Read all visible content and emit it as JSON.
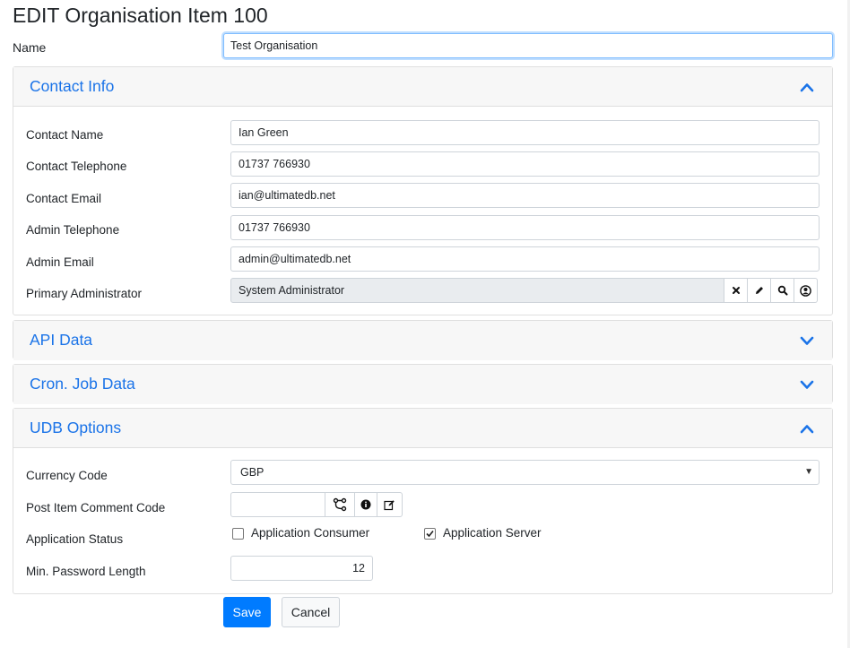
{
  "page": {
    "title": "EDIT Organisation Item 100"
  },
  "name_field": {
    "label": "Name",
    "value": "Test Organisation"
  },
  "sections": {
    "contact": {
      "title": "Contact Info",
      "expanded": true,
      "fields": {
        "contact_name": {
          "label": "Contact Name",
          "value": "Ian Green"
        },
        "contact_telephone": {
          "label": "Contact Telephone",
          "value": "01737 766930"
        },
        "contact_email": {
          "label": "Contact Email",
          "value": "ian@ultimatedb.net"
        },
        "admin_telephone": {
          "label": "Admin Telephone",
          "value": "01737 766930"
        },
        "admin_email": {
          "label": "Admin Email",
          "value": "admin@ultimatedb.net"
        },
        "primary_admin": {
          "label": "Primary Administrator",
          "value": "System Administrator"
        }
      }
    },
    "api": {
      "title": "API Data",
      "expanded": false
    },
    "cron": {
      "title": "Cron. Job Data",
      "expanded": false
    },
    "udb": {
      "title": "UDB Options",
      "expanded": true,
      "fields": {
        "currency_code": {
          "label": "Currency Code",
          "value": "GBP"
        },
        "post_item_comment_code": {
          "label": "Post Item Comment Code",
          "value": ""
        },
        "application_status": {
          "label": "Application Status",
          "consumer": {
            "label": "Application Consumer",
            "checked": false
          },
          "server": {
            "label": "Application Server",
            "checked": true
          }
        },
        "min_password_length": {
          "label": "Min. Password Length",
          "value": "12"
        }
      }
    }
  },
  "buttons": {
    "save": "Save",
    "cancel": "Cancel"
  },
  "icons": {
    "chevron_up": "chevron-up-icon",
    "chevron_down": "chevron-down-icon",
    "clear": "times-icon",
    "edit": "pencil-icon",
    "search": "search-icon",
    "user": "user-circle-icon",
    "workflow": "workflow-icon",
    "info": "info-icon",
    "note_edit": "edit-note-icon"
  },
  "colors": {
    "accent": "#1a73e8",
    "primary": "#007bff"
  }
}
